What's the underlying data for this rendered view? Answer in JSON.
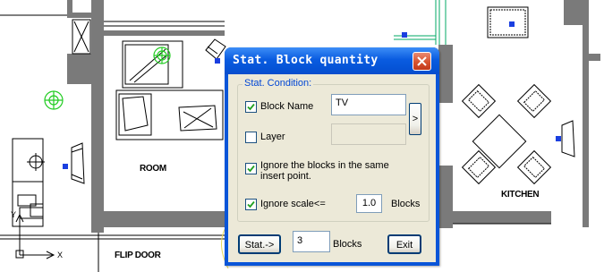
{
  "drawing": {
    "labels": {
      "room": "ROOM",
      "kitchen": "KITCHEN",
      "flip_door": "FLIP DOOR",
      "axis_y": "Y",
      "axis_x": "X"
    },
    "colors": {
      "wall": "#777777",
      "line": "#000000",
      "plant": "#22cc22",
      "grip": "#1a3fe0",
      "glazing": "#00aa66"
    }
  },
  "dialog": {
    "title": "Stat. Block quantity",
    "close_icon": "close-x-icon",
    "group_label": "Stat. Condition:",
    "block_name": {
      "label": "Block Name",
      "checked": true,
      "value": "TV"
    },
    "pick_button_label": ">",
    "layer": {
      "label": "Layer",
      "checked": false,
      "value": ""
    },
    "ignore_same_point": {
      "label_line1": "Ignore the blocks in the same",
      "label_line2": "insert point.",
      "checked": true
    },
    "ignore_scale": {
      "label": "Ignore scale<=",
      "checked": true,
      "value": "1.0",
      "unit": "Blocks"
    },
    "stat_button_label": "Stat.->",
    "result": {
      "value": "3",
      "unit": "Blocks"
    },
    "exit_button_label": "Exit",
    "colors": {
      "titlebar": "#0a55d8",
      "client": "#ece9d8",
      "group_label": "#0046d5",
      "close": "#d7532f"
    }
  }
}
